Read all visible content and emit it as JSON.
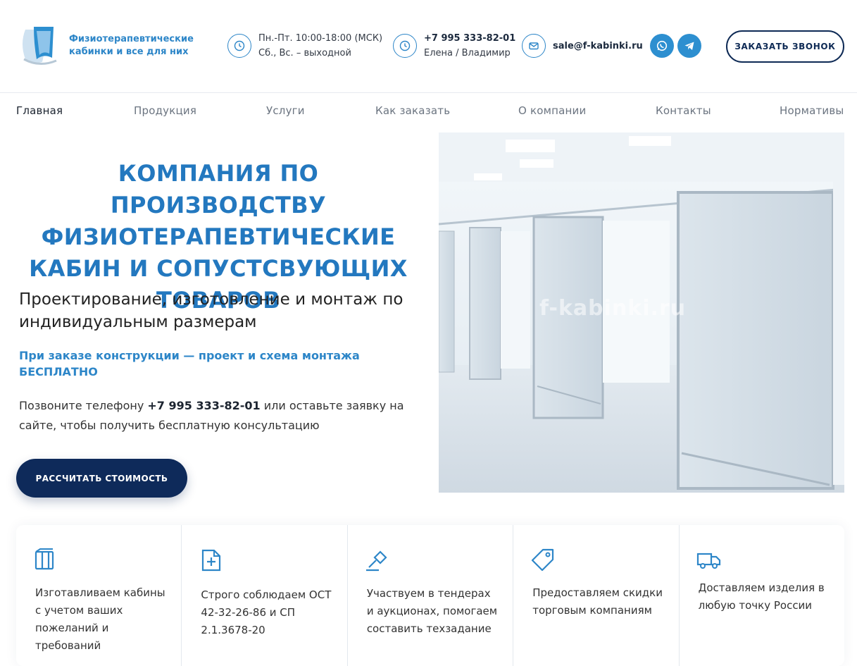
{
  "header": {
    "logo_text": "Физиотерапевтические кабинки и все для них",
    "hours": {
      "line1": "Пн.-Пт. 10:00-18:00 (МСК)",
      "line2": "Сб., Вс. – выходной",
      "icon": "clock-icon"
    },
    "phone": {
      "number": "+7 995 333-82-01",
      "names": "Елена / Владимир",
      "icon": "clock-icon"
    },
    "email": {
      "address": "sale@f-kabinki.ru",
      "icon": "mail-icon"
    },
    "socials": [
      "whatsapp-icon",
      "telegram-icon"
    ],
    "callback_button": "ЗАКАЗАТЬ ЗВОНОК"
  },
  "nav": {
    "items": [
      {
        "label": "Главная",
        "active": true
      },
      {
        "label": "Продукция"
      },
      {
        "label": "Услуги"
      },
      {
        "label": "Как заказать"
      },
      {
        "label": "О компании"
      },
      {
        "label": "Контакты"
      },
      {
        "label": "Нормативы"
      }
    ]
  },
  "hero": {
    "title": "КОМПАНИЯ ПО ПРОИЗВОДСТВУ ФИЗИОТЕРАПЕВТИЧЕСКИЕ КАБИН И СОПУСТСВУЮЩИХ ТОВАРОВ",
    "subtitle": "Проектирование, изготовление и монтаж по индивидуальным размерам",
    "promo": "При заказе конструкции — проект и схема монтажа БЕСПЛАТНО",
    "text_before": "Позвоните телефону ",
    "text_phone": "+7 995 333-82-01",
    "text_after": " или оставьте заявку на сайте, чтобы получить бесплатную консультацию",
    "cta_button": "РАССЧИТАТЬ СТОИМОСТЬ",
    "image_watermark": "f-kabinki.ru"
  },
  "features": [
    {
      "icon": "cabin-icon",
      "text": "Изготавливаем кабины с учетом ваших пожеланий и требований"
    },
    {
      "icon": "document-plus-icon",
      "text": "Строго соблюдаем ОСТ 42-32-26-86 и СП 2.1.3678-20"
    },
    {
      "icon": "gavel-icon",
      "text": "Участвуем в тендерах и аукционах, помогаем составить техзадание"
    },
    {
      "icon": "tag-icon",
      "text": "Предоставляем скидки торговым компаниям"
    },
    {
      "icon": "truck-icon",
      "text": "Доставляем изделия в любую точку России"
    }
  ],
  "colors": {
    "accent": "#2d86c8",
    "dark": "#0e2a5a"
  }
}
